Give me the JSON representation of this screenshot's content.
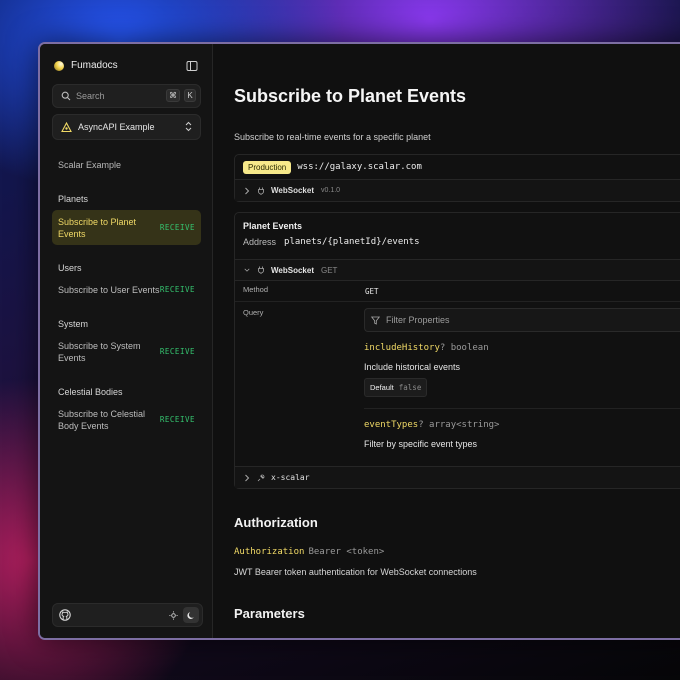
{
  "sidebar": {
    "brand": "Fumadocs",
    "search": {
      "placeholder": "Search",
      "kbd": [
        "⌘",
        "K"
      ]
    },
    "selector": {
      "label": "AsyncAPI Example"
    },
    "top_link": "Scalar Example",
    "sections": [
      {
        "title": "Planets",
        "items": [
          {
            "label": "Subscribe to Planet Events",
            "badge": "RECEIVE",
            "active": true
          }
        ]
      },
      {
        "title": "Users",
        "items": [
          {
            "label": "Subscribe to User Events",
            "badge": "RECEIVE"
          }
        ]
      },
      {
        "title": "System",
        "items": [
          {
            "label": "Subscribe to System Events",
            "badge": "RECEIVE"
          }
        ]
      },
      {
        "title": "Celestial Bodies",
        "items": [
          {
            "label": "Subscribe to Celestial Body Events",
            "badge": "RECEIVE"
          }
        ]
      }
    ]
  },
  "main": {
    "title": "Subscribe to Planet Events",
    "description": "Subscribe to real-time events for a specific planet",
    "server": {
      "badge": "Production",
      "url": "wss://galaxy.scalar.com",
      "binding": "WebSocket",
      "version": "v0.1.0"
    },
    "operation": {
      "name": "Planet Events",
      "address_label": "Address",
      "address": "planets/{planetId}/events",
      "binding": "WebSocket",
      "binding_method": "GET",
      "method_label": "Method",
      "method_value": "GET",
      "query_label": "Query",
      "filter_placeholder": "Filter Properties",
      "properties": [
        {
          "name": "includeHistory",
          "type": "? boolean",
          "description": "Include historical events",
          "default_label": "Default",
          "default_value": "false"
        },
        {
          "name": "eventTypes",
          "type": "? array<string>",
          "description": "Filter by specific event types"
        }
      ],
      "extension": "x-scalar"
    },
    "authorization": {
      "heading": "Authorization",
      "key": "Authorization",
      "type": "Bearer <token>",
      "description": "JWT Bearer token authentication for WebSocket connections"
    },
    "parameters_heading": "Parameters"
  }
}
